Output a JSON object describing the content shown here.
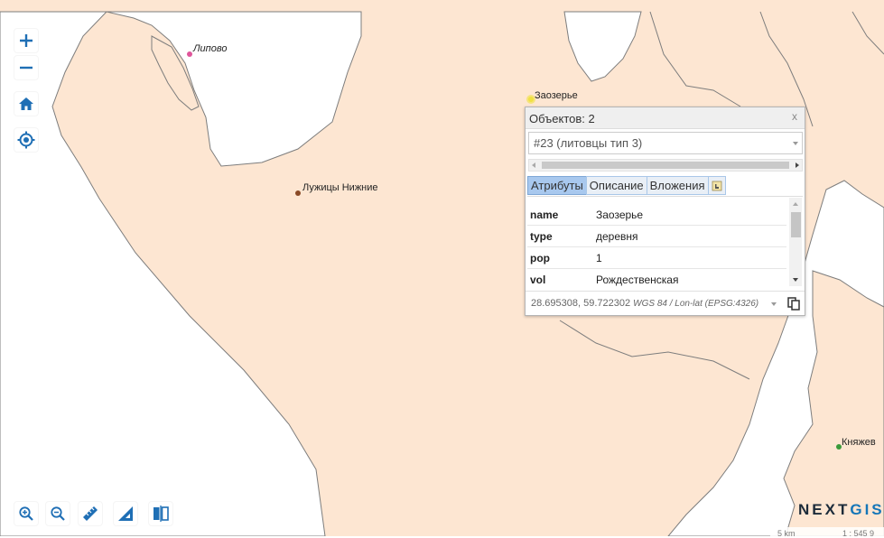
{
  "map": {
    "land_color": "#fde6d2",
    "water_color": "#ffffff",
    "border_color": "#7d7d7d"
  },
  "controls": {
    "zoom_in_icon": "plus-icon",
    "zoom_out_icon": "minus-icon",
    "home_icon": "home-icon",
    "locate_icon": "crosshair-icon",
    "accent": "#1f6fb5"
  },
  "bottom_toolbar": [
    "zoom-in-box-icon",
    "zoom-out-box-icon",
    "measure-distance-icon",
    "measure-area-icon",
    "swipe-compare-icon"
  ],
  "places": [
    {
      "name": "Липово",
      "color": "#e0559b"
    },
    {
      "name": "Лужицы Нижние",
      "color": "#8a4a26"
    },
    {
      "name": "Заозерье",
      "color": "#f0e142"
    },
    {
      "name": "Княжев",
      "color": "#3a9a3a"
    }
  ],
  "popup": {
    "title": "Объектов: 2",
    "close": "x",
    "selected_object": "#23 (литовцы тип 3)",
    "tabs": [
      "Атрибуты",
      "Описание",
      "Вложения"
    ],
    "active_tab": "Атрибуты",
    "attributes": [
      {
        "key": "name",
        "value": "Заозерье"
      },
      {
        "key": "type",
        "value": "деревня"
      },
      {
        "key": "pop",
        "value": "1"
      },
      {
        "key": "vol",
        "value": "Рождественская"
      }
    ],
    "coordinates": "28.695308, 59.722302",
    "crs": "WGS 84 / Lon-lat (EPSG:4326)"
  },
  "logo": {
    "part1": "NEXT",
    "part2": "GIS"
  },
  "scale": {
    "distance": "5 km",
    "ratio": "1 : 545 9"
  }
}
